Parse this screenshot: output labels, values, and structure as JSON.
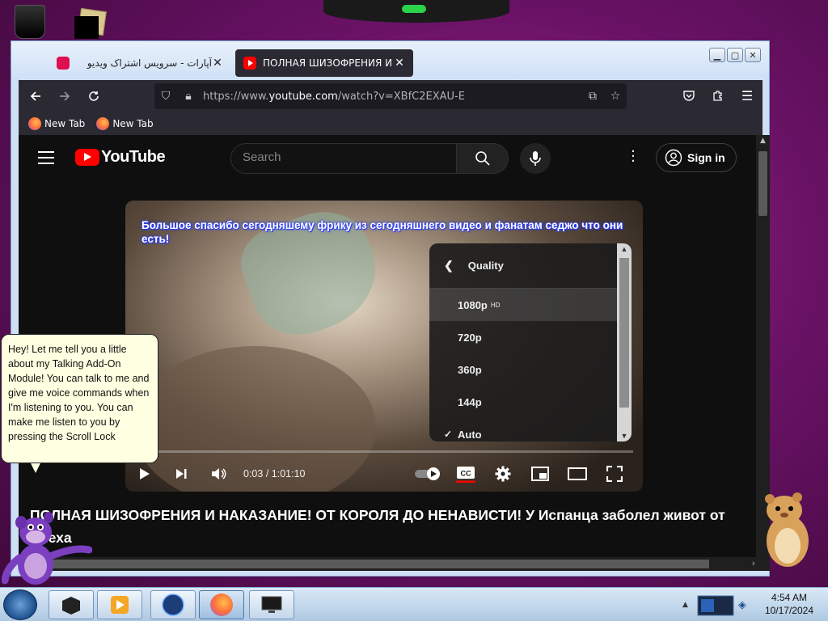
{
  "browser": {
    "tabs": [
      {
        "title": "آپارات - سرویس اشتراک ویدیو",
        "active": false
      },
      {
        "title": "ПОЛНАЯ ШИЗОФРЕНИЯ И НАКАЗ",
        "active": true
      }
    ],
    "url_prefix": "https://www.",
    "url_domain": "youtube.com",
    "url_suffix": "/watch?v=XBfC2EXAU-E",
    "bookmarks": [
      "New Tab",
      "New Tab"
    ]
  },
  "youtube": {
    "logo_text": "YouTube",
    "search_placeholder": "Search",
    "sign_in_label": "Sign in",
    "subtitle_text": "Большое спасибо сегодняшему фрику из сегодняшнего видео и фанатам седжо что они есть!",
    "current_time": "0:03",
    "duration": "1:01:10",
    "progress_fraction": 0.0008,
    "time_separator": " / ",
    "quality_menu": {
      "header": "Quality",
      "options": [
        {
          "label": "1080p",
          "badge": "HD",
          "highlighted": true,
          "checked": false
        },
        {
          "label": "720p",
          "badge": "",
          "highlighted": false,
          "checked": false
        },
        {
          "label": "360p",
          "badge": "",
          "highlighted": false,
          "checked": false
        },
        {
          "label": "144p",
          "badge": "",
          "highlighted": false,
          "checked": false
        },
        {
          "label": "Auto",
          "badge": "",
          "highlighted": false,
          "checked": true
        }
      ]
    },
    "video_title": "ПОЛНАЯ ШИЗОФРЕНИЯ И НАКАЗАНИЕ! ОТ КОРОЛЯ ДО НЕНАВИСТИ! У Испанца заболел живот от смеха"
  },
  "assistant": {
    "bubble_text": "Hey! Let me tell you a little about my Talking Add-On Module! You can talk to me and give me voice commands when I'm listening to you. You can make me listen to you by pressing the Scroll Lock"
  },
  "taskbar": {
    "time": "4:54 AM",
    "date": "10/17/2024"
  },
  "colors": {
    "youtube_red": "#ff0000",
    "browser_toolbar": "#2b2a33",
    "bubble_bg": "#ffffe1"
  }
}
